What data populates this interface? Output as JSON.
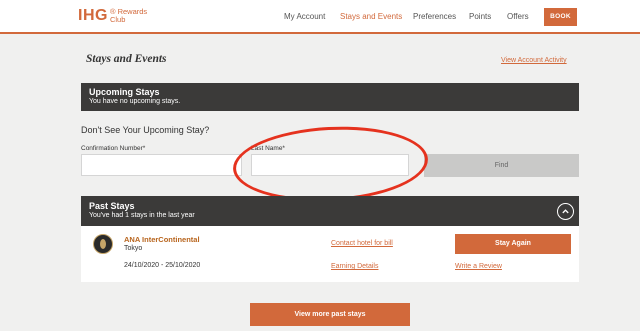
{
  "header": {
    "logo_main": "IHG",
    "logo_sub_line1": "® Rewards",
    "logo_sub_line2": "Club",
    "nav": [
      "My Account",
      "Stays and Events",
      "Preferences",
      "Points",
      "Offers"
    ],
    "active_nav": "Stays and Events",
    "book_label": "BOOK",
    "accent_color": "#d2693b"
  },
  "page": {
    "title": "Stays and Events",
    "view_activity_link": "View Account Activity"
  },
  "upcoming": {
    "title": "Upcoming Stays",
    "subtitle": "You have no upcoming stays."
  },
  "find_stay": {
    "question": "Don't See Your Upcoming Stay?",
    "confirmation_label": "Confirmation Number*",
    "confirmation_value": "",
    "last_name_label": "Last Name*",
    "last_name_value": "",
    "find_label": "Find"
  },
  "past": {
    "title": "Past Stays",
    "subtitle": "You've had 1 stays in the last year",
    "collapse_icon": "chevron-up-icon",
    "stays": [
      {
        "hotel": "ANA InterContinental",
        "city": "Tokyo",
        "dates": "24/10/2020 - 25/10/2020",
        "contact_link": "Contact hotel for bill",
        "earning_link": "Earning Details",
        "stay_again_label": "Stay Again",
        "review_link": "Write a Review"
      }
    ],
    "more_label": "View more past stays"
  },
  "annotation": {
    "color": "#e5321e"
  }
}
